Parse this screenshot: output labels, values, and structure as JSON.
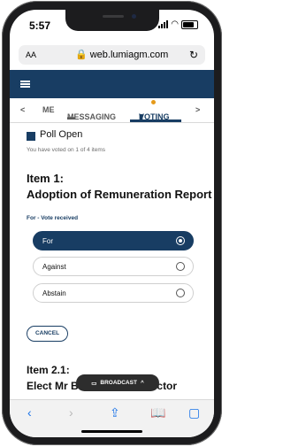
{
  "status": {
    "time": "5:57"
  },
  "browser": {
    "aa": "AA",
    "url": "web.lumiagm.com",
    "lock_icon": "lock-icon",
    "reload_icon": "reload-icon"
  },
  "tabs": {
    "prev": "<",
    "me": "ME",
    "messaging": "MESSAGING",
    "voting": "VOTING",
    "next": ">"
  },
  "poll": {
    "title": "Poll Open",
    "voted_text": "You have voted on 1 of 4 items"
  },
  "item1": {
    "number": "Item 1:",
    "title": "Adoption of Remuneration Report",
    "status": "For - Vote received"
  },
  "options": [
    {
      "label": "For",
      "selected": true
    },
    {
      "label": "Against",
      "selected": false
    },
    {
      "label": "Abstain",
      "selected": false
    }
  ],
  "cancel_label": "CANCEL",
  "item2": {
    "number": "Item 2.1:",
    "title": "Elect Mr B... a director",
    "title_left": "Elect Mr B",
    "title_right": "a director"
  },
  "broadcast": {
    "label": "BROADCAST",
    "icon": "cast-icon"
  },
  "bottom_bar": {
    "icons": [
      "back-icon",
      "forward-icon",
      "share-icon",
      "book-icon",
      "tabs-icon"
    ]
  },
  "colors": {
    "navy": "#183d63",
    "orange": "#e59a1a",
    "browser_blue": "#1a73e8"
  }
}
